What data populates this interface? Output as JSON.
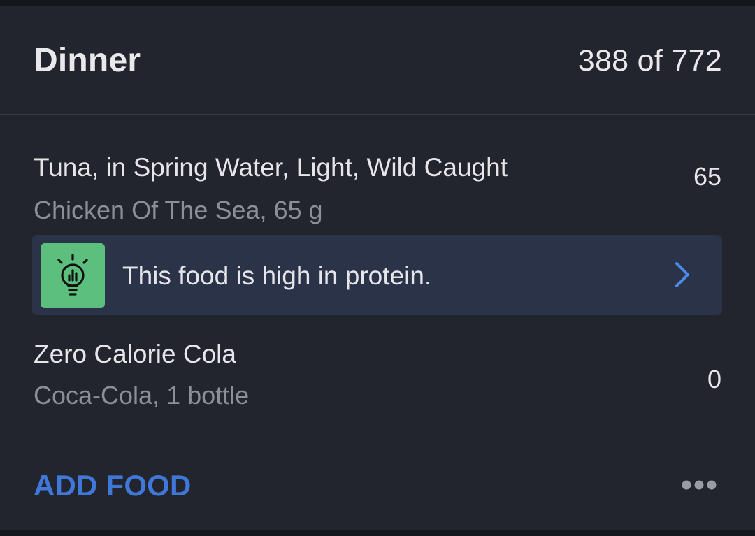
{
  "meal": {
    "title": "Dinner",
    "total": "388 of 772"
  },
  "foods": [
    {
      "name": "Tuna, in Spring Water, Light, Wild Caught",
      "detail": "Chicken Of The Sea, 65 g",
      "calories": "65"
    },
    {
      "name": "Zero Calorie Cola",
      "detail": "Coca-Cola, 1 bottle",
      "calories": "0"
    }
  ],
  "insight": {
    "icon": "lightbulb-icon",
    "text": "This food is high in protein."
  },
  "actions": {
    "add_food_label": "ADD FOOD",
    "more_icon": "ellipsis-icon"
  },
  "colors": {
    "background": "#23252e",
    "accent": "#3f78d8",
    "insight_background": "#2a3347",
    "insight_icon_background": "#5cbf7d"
  }
}
